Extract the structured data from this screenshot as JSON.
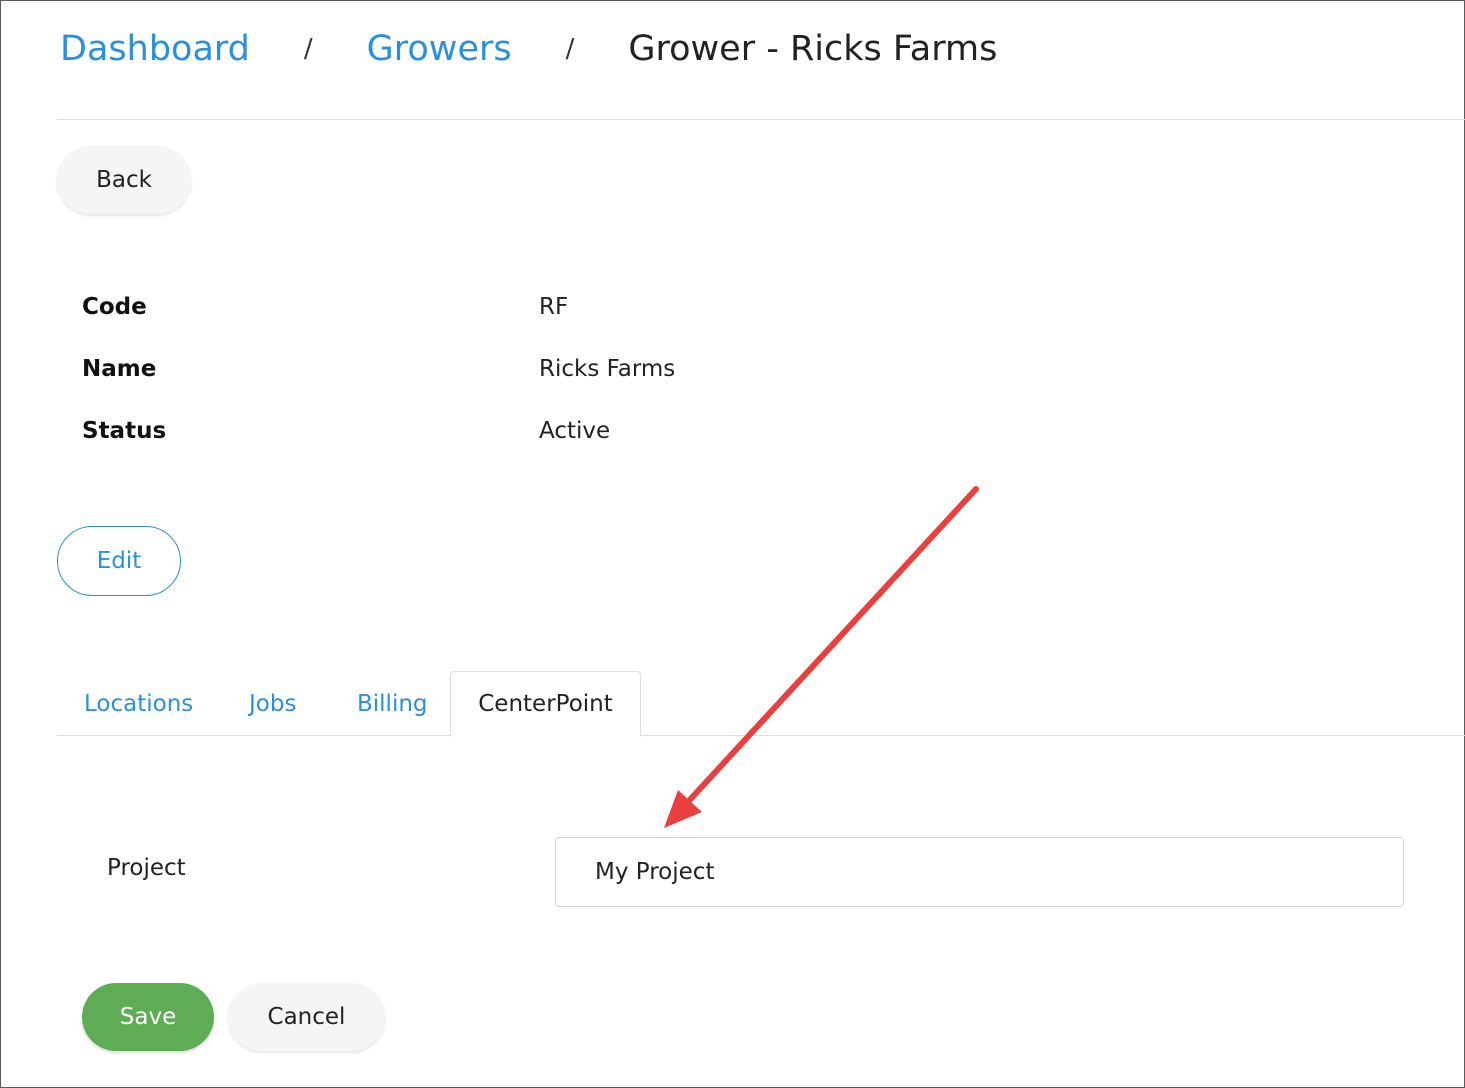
{
  "breadcrumb": {
    "items": [
      "Dashboard",
      "Growers"
    ],
    "separator": "/",
    "current": "Grower - Ricks Farms"
  },
  "actions": {
    "back_label": "Back",
    "edit_label": "Edit",
    "save_label": "Save",
    "cancel_label": "Cancel"
  },
  "details": [
    {
      "label": "Code",
      "value": "RF"
    },
    {
      "label": "Name",
      "value": "Ricks Farms"
    },
    {
      "label": "Status",
      "value": "Active"
    }
  ],
  "tabs": [
    {
      "label": "Locations",
      "active": false
    },
    {
      "label": "Jobs",
      "active": false
    },
    {
      "label": "Billing",
      "active": false
    },
    {
      "label": "CenterPoint",
      "active": true
    }
  ],
  "form": {
    "project_label": "Project",
    "project_value": "My Project"
  },
  "colors": {
    "link": "#2b8fe0",
    "save": "#5fac57",
    "annotation_arrow": "#e8403f"
  },
  "annotation": {
    "icon": "arrow-icon"
  }
}
